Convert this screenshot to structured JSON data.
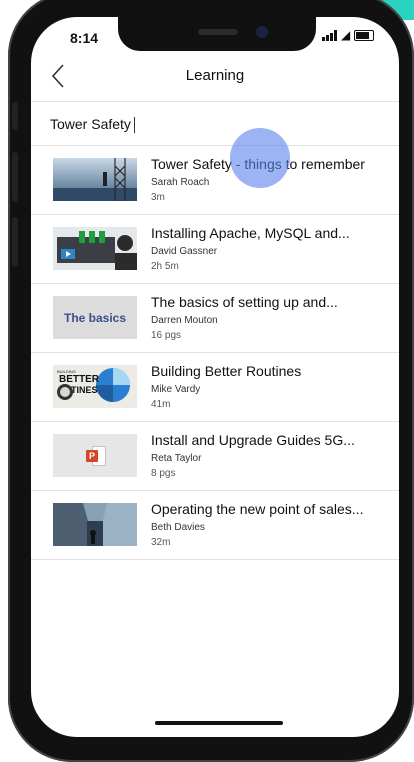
{
  "status_bar": {
    "time": "8:14"
  },
  "nav": {
    "back_icon": "chevron-left-icon",
    "title": "Learning"
  },
  "search": {
    "value": "Tower Safety"
  },
  "items": [
    {
      "title": "Tower Safety - things to remember",
      "author": "Sarah Roach",
      "meta": "3m"
    },
    {
      "title": "Installing Apache, MySQL and...",
      "author": "David Gassner",
      "meta": "2h 5m"
    },
    {
      "title": "The basics of setting up and...",
      "author": "Darren Mouton",
      "meta": "16 pgs",
      "thumb_text": "The basics"
    },
    {
      "title": "Building Better Routines",
      "author": "Mike Vardy",
      "meta": "41m",
      "thumb_text_top": "BUILDING",
      "thumb_text_mid": "BETTER",
      "thumb_text_bot": "TINES"
    },
    {
      "title": "Install and Upgrade Guides 5G...",
      "author": "Reta Taylor",
      "meta": "8 pgs",
      "thumb_text": "P"
    },
    {
      "title": "Operating the new point of sales...",
      "author": "Beth Davies",
      "meta": "32m"
    }
  ],
  "colors": {
    "accent_teal": "#2ad3c0",
    "touch_indicator": "#5a82eb",
    "basics_text": "#3a4e8c"
  }
}
